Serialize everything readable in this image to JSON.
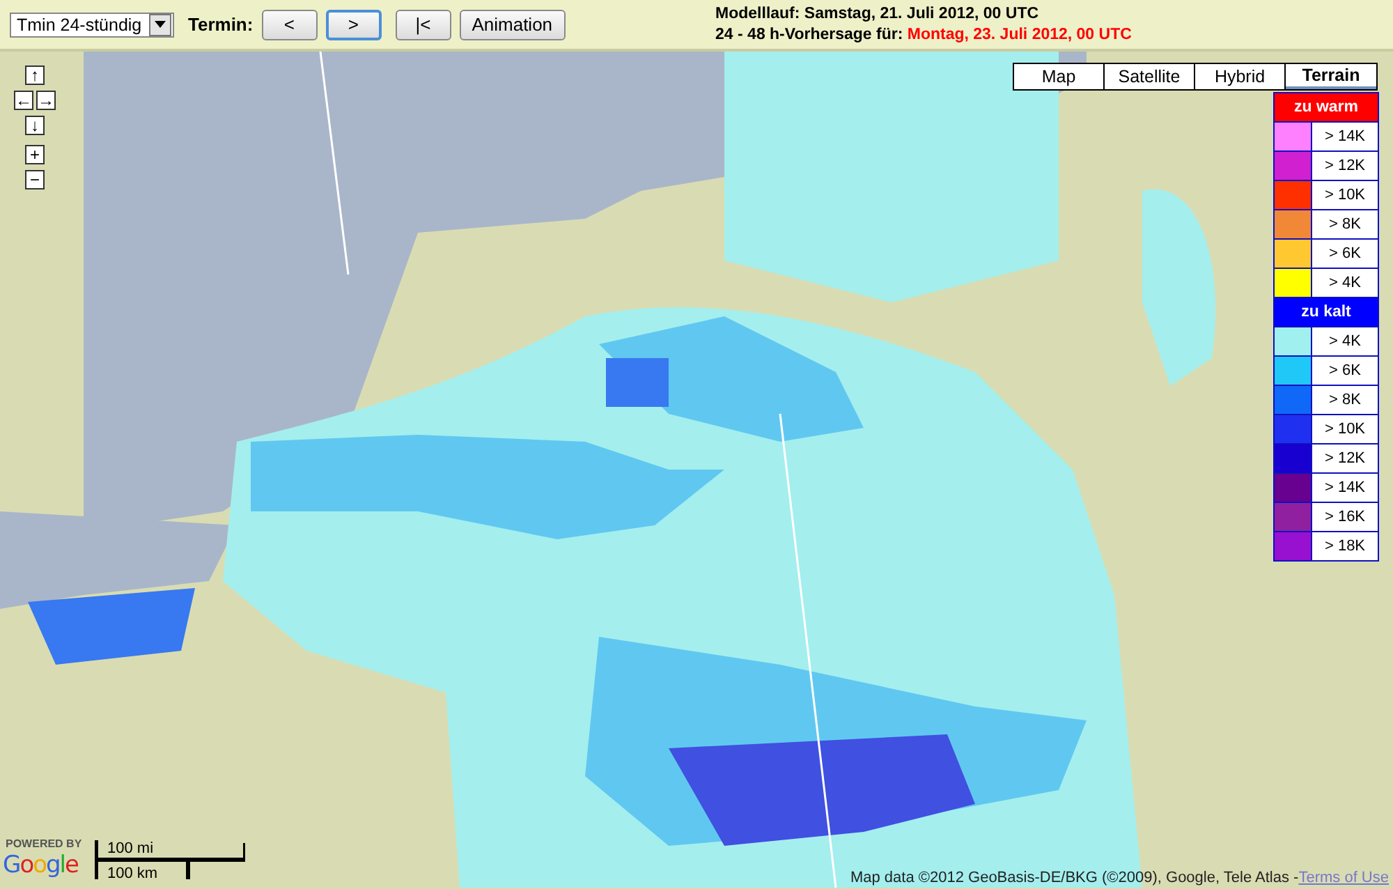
{
  "toolbar": {
    "product_dropdown": {
      "value": "Tmin 24-stündig"
    },
    "termin_label": "Termin:",
    "buttons": [
      {
        "label": "<",
        "focused": false
      },
      {
        "label": ">",
        "focused": true
      },
      {
        "label": "|<",
        "focused": false
      },
      {
        "label": "Animation",
        "focused": false
      }
    ],
    "model_run": "Modelllauf: Samstag, 21. Juli 2012, 00 UTC",
    "forecast_label": "24 - 48 h-Vorhersage für:",
    "forecast_date": "Montag, 23. Juli 2012, 00 UTC"
  },
  "map": {
    "pan_controls": [
      "↑",
      "←",
      "→",
      "↓"
    ],
    "zoom_controls": [
      "+",
      "−"
    ],
    "map_types": [
      {
        "label": "Map",
        "selected": false
      },
      {
        "label": "Satellite",
        "selected": false
      },
      {
        "label": "Hybrid",
        "selected": false
      },
      {
        "label": "Terrain",
        "selected": true
      }
    ],
    "legend": [
      {
        "title": "zu warm",
        "color": "#ff0000",
        "items": [
          {
            "label": "> 14K",
            "color": "#ff80ff"
          },
          {
            "label": "> 12K",
            "color": "#d020d0"
          },
          {
            "label": "> 10K",
            "color": "#ff3000"
          },
          {
            "label": "> 8K",
            "color": "#f08838"
          },
          {
            "label": "> 6K",
            "color": "#ffc830"
          },
          {
            "label": "> 4K",
            "color": "#ffff00"
          }
        ]
      },
      {
        "title": "zu kalt",
        "color": "#0000ff",
        "items": [
          {
            "label": "> 4K",
            "color": "#a0f0f0"
          },
          {
            "label": "> 6K",
            "color": "#20c8f8"
          },
          {
            "label": "> 8K",
            "color": "#1068f8"
          },
          {
            "label": "> 10K",
            "color": "#2030f0"
          },
          {
            "label": "> 12K",
            "color": "#1800d0"
          },
          {
            "label": "> 14K",
            "color": "#680090"
          },
          {
            "label": "> 16K",
            "color": "#9020a0"
          },
          {
            "label": "> 18K",
            "color": "#9810d0"
          }
        ]
      }
    ],
    "powered_by": "POWERED BY",
    "logo": "Google",
    "scale": {
      "miles": "100 mi",
      "km": "100 km"
    },
    "attribution": "Map data ©2012 GeoBasis-DE/BKG (©2009), Google, Tele Atlas - ",
    "terms_link": "Terms of Use"
  }
}
